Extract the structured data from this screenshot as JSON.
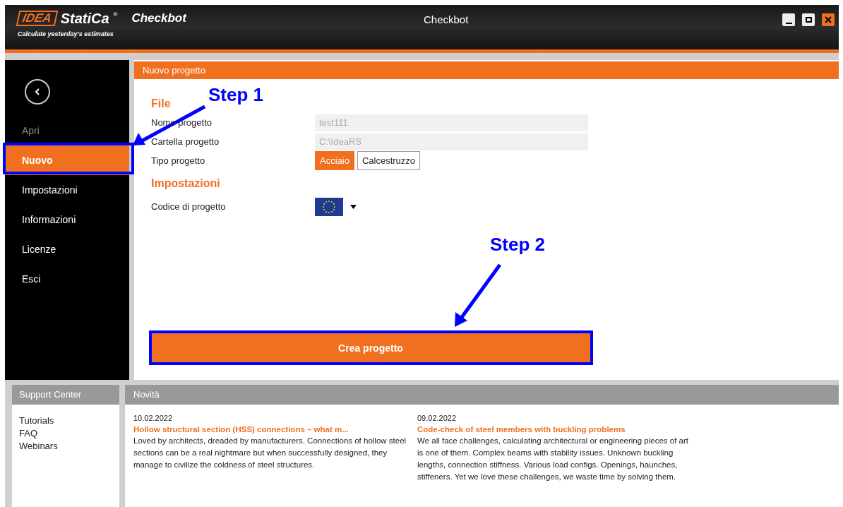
{
  "header": {
    "logo_mark": "IDEA",
    "logo_name": "StatiCa",
    "registered": "®",
    "product": "Checkbot",
    "tagline": "Calculate yesterday's estimates",
    "title": "Checkbot"
  },
  "sidebar": {
    "items": [
      {
        "label": "Apri",
        "selected": false,
        "disabled": true
      },
      {
        "label": "Nuovo",
        "selected": true,
        "disabled": false
      },
      {
        "label": "Impostazioni",
        "selected": false,
        "disabled": false
      },
      {
        "label": "Informazioni",
        "selected": false,
        "disabled": false
      },
      {
        "label": "Licenze",
        "selected": false,
        "disabled": false
      },
      {
        "label": "Esci",
        "selected": false,
        "disabled": false
      }
    ]
  },
  "panel": {
    "title": "Nuovo progetto",
    "sections": [
      {
        "heading": "File",
        "rows": [
          {
            "kind": "text",
            "label": "Nome progetto",
            "value": "test111"
          },
          {
            "kind": "text",
            "label": "Cartella progetto",
            "value": "C:\\IdeaRS"
          },
          {
            "kind": "toggle",
            "label": "Tipo progetto",
            "options": [
              {
                "label": "Acciaio",
                "selected": true
              },
              {
                "label": "Calcestruzzo",
                "selected": false
              }
            ]
          }
        ]
      },
      {
        "heading": "Impostazioni",
        "rows": [
          {
            "kind": "flag",
            "label": "Codice di progetto"
          }
        ]
      }
    ],
    "create_button": "Crea progetto"
  },
  "support": {
    "title": "Support Center",
    "links": [
      "Tutorials",
      "FAQ",
      "Webinars"
    ]
  },
  "news": {
    "title": "Novità",
    "items": [
      {
        "date": "10.02.2022",
        "title": "Hollow structural section (HSS) connections – what m...",
        "text": "Loved by architects, dreaded by manufacturers. Connections of hollow steel sections can be a real nightmare but when successfully designed, they manage to civilize the coldness of steel structures."
      },
      {
        "date": "09.02.2022",
        "title": "Code-check of steel members with buckling problems",
        "text": "We all face challenges, calculating architectural or engineering pieces of art is one of them. Complex beams with stability issues. Unknown buckling lengths, connection stiffness. Various load configs. Openings, haunches, stiffeners. Yet we love these challenges, we waste time by solving them."
      }
    ]
  },
  "annotations": [
    {
      "label": "Step 1"
    },
    {
      "label": "Step 2"
    }
  ]
}
